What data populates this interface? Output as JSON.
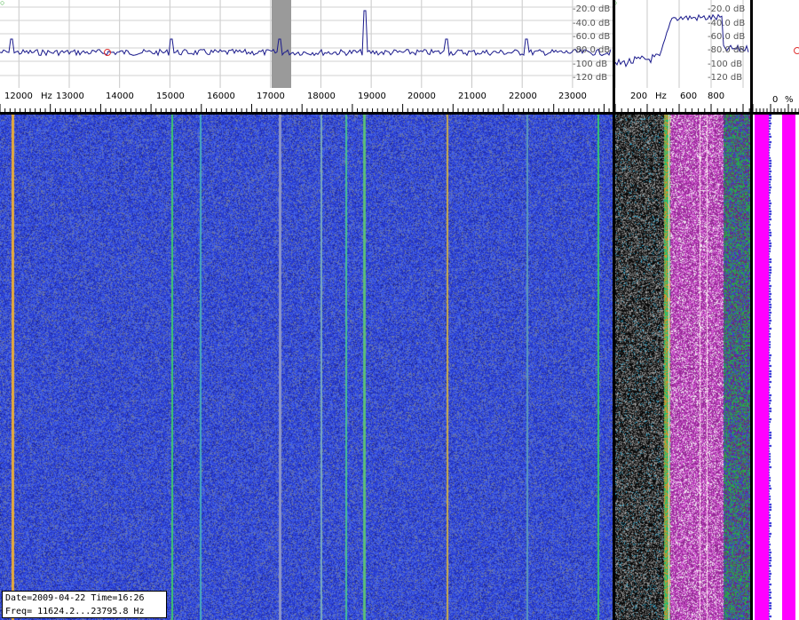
{
  "main_spectrum": {
    "db_labels": [
      "-20.0 dB",
      "-40.0 dB",
      "-60.0 dB",
      "-80.0 dB",
      "-100 dB",
      "-120 dB"
    ],
    "peak_freqs_hz": [
      11870,
      15040,
      17180,
      18860,
      20510,
      22090
    ]
  },
  "main_scale": {
    "unit": "Hz",
    "labels": [
      "12000",
      "13000",
      "14000",
      "15000",
      "16000",
      "17000",
      "18000",
      "19000",
      "20000",
      "21000",
      "22000",
      "23000"
    ],
    "freq_min_hz": 11624.2,
    "freq_max_hz": 23795.8
  },
  "zoom_spectrum": {
    "db_labels": [
      "-20.0 dB",
      "-40.0 dB",
      "-60.0 dB",
      "-80.0 dB",
      "-100 dB",
      "-120 dB"
    ]
  },
  "zoom_scale": {
    "unit": "Hz",
    "labels": [
      "200",
      "600",
      "800"
    ]
  },
  "right_scale": {
    "value": "0",
    "unit": "%"
  },
  "info": {
    "date_time": "Date=2009-04-22 Time=16:26",
    "freq_range": "Freq= 11624.2...23795.8 Hz"
  },
  "colors": {
    "spectrum_trace": "#1a1a8c",
    "waterfall_background": "#3b4fd6",
    "zoom_waterfall_background": "#6a1a7a",
    "bar_magenta": "#ff00ff",
    "signal_orange": "#e0a030",
    "signal_green": "#30c060"
  }
}
